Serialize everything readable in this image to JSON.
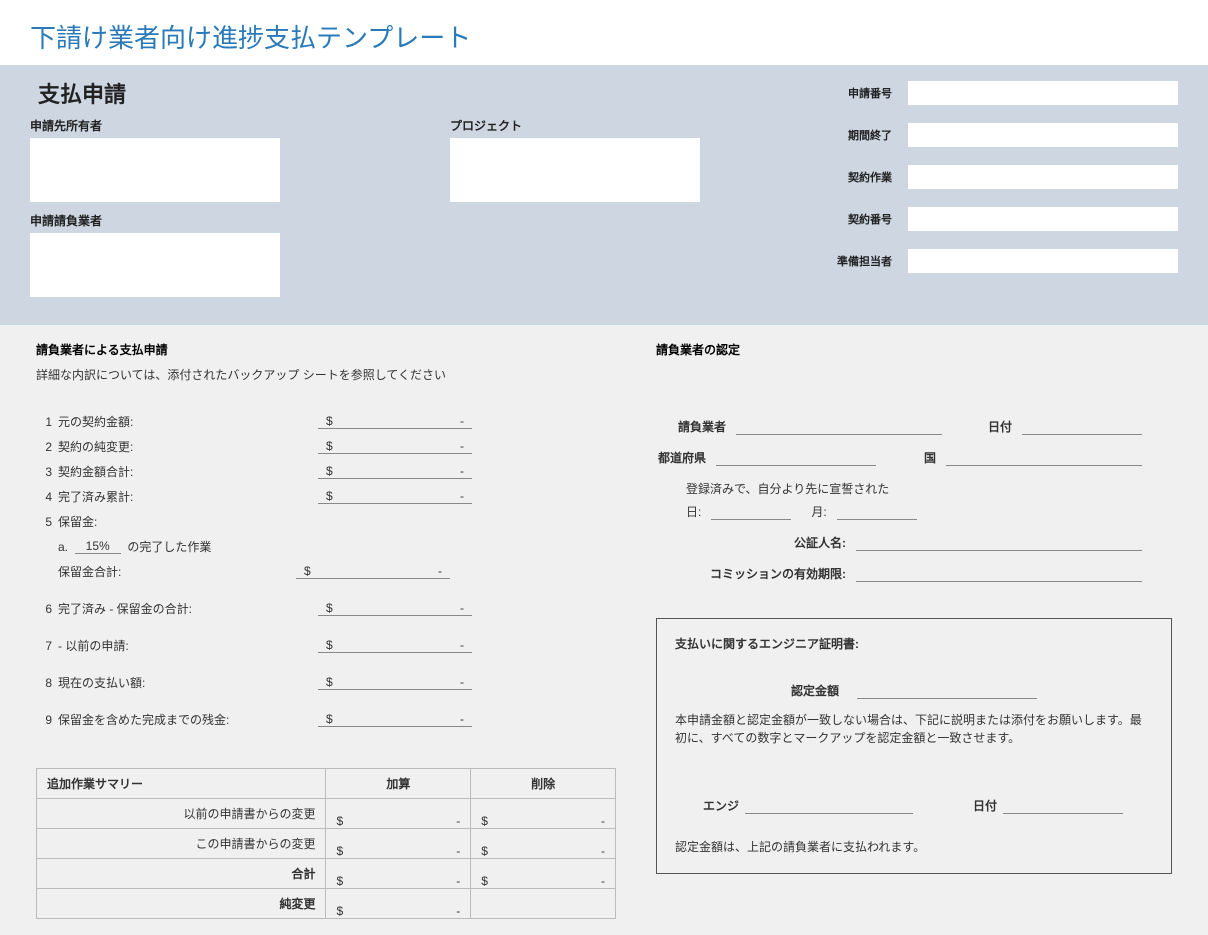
{
  "title": "下請け業者向け進捗支払テンプレート",
  "header": {
    "heading": "支払申請",
    "owner_label": "申請先所有者",
    "project_label": "プロジェクト",
    "contractor_label": "申請請負業者",
    "right": {
      "app_no": "申請番号",
      "period_end": "期間終了",
      "contract_work": "契約作業",
      "contract_no": "契約番号",
      "prepared_by": "準備担当者"
    }
  },
  "left": {
    "section_title": "請負業者による支払申請",
    "subnote": "詳細な内訳については、添付されたバックアップ シートを参照してください",
    "items": {
      "n1": "1",
      "l1": "元の契約金額:",
      "n2": "2",
      "l2": "契約の純変更:",
      "n3": "3",
      "l3": "契約金額合計:",
      "n4": "4",
      "l4": "完了済み累計:",
      "n5": "5",
      "l5": "保留金:",
      "retain_a": "a.",
      "retain_pct": "15%",
      "retain_text": "の完了した作業",
      "retain_total": "保留金合計:",
      "n6": "6",
      "l6": "完了済み - 保留金の合計:",
      "n7": "7",
      "l7": "- 以前の申請:",
      "n8": "8",
      "l8": "現在の支払い額:",
      "n9": "9",
      "l9": "保留金を含めた完成までの残金:"
    },
    "dollar": "$",
    "dash": "-"
  },
  "right": {
    "section_title": "請負業者の認定",
    "contractor_label": "請負業者",
    "date_label": "日付",
    "state_label": "都道府県",
    "country_label": "国",
    "registered_text": "登録済みで、自分より先に宣誓された",
    "day_label": "日:",
    "month_label": "月:",
    "notary_label": "公証人名:",
    "commission_label": "コミッションの有効期限:"
  },
  "eng": {
    "title": "支払いに関するエンジニア証明書:",
    "amount_label": "認定金額",
    "text": "本申請金額と認定金額が一致しない場合は、下記に説明または添付をお願いします。最初に、すべての数字とマークアップを認定金額と一致させます。",
    "engineer_label": "エンジ",
    "date_label": "日付",
    "footer": "認定金額は、上記の請負業者に支払われます。"
  },
  "summary": {
    "title": "追加作業サマリー",
    "col_add": "加算",
    "col_del": "削除",
    "row_prev": "以前の申請書からの変更",
    "row_this": "この申請書からの変更",
    "row_total": "合計",
    "row_net": "純変更",
    "dollar": "$",
    "dash": "-"
  }
}
